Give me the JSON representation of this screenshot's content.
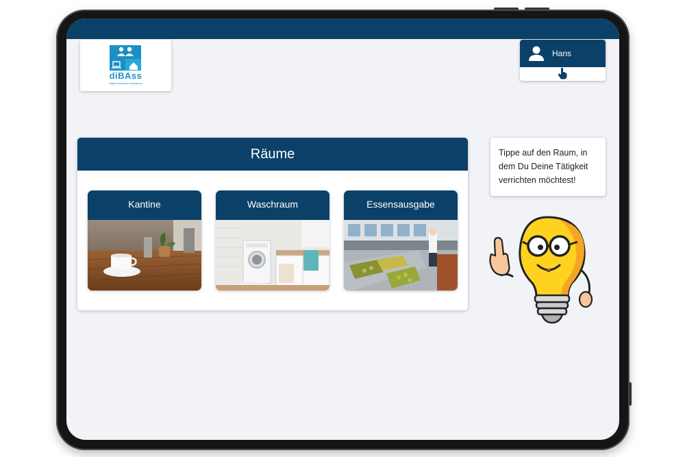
{
  "logo": {
    "name": "diBAss",
    "tagline": "digital Assistant-Assistance"
  },
  "user": {
    "name": "Hans"
  },
  "rooms_panel": {
    "title": "Räume",
    "rooms": [
      {
        "label": "Kantine"
      },
      {
        "label": "Waschraum"
      },
      {
        "label": "Essensausgabe"
      }
    ]
  },
  "hint": {
    "text": "Tippe auf den Raum, in dem Du Deine Tätigkeit verrichten möchtest!"
  },
  "colors": {
    "primary": "#0b4168",
    "background": "#f2f3f7",
    "logo": "#1b8fc6"
  },
  "icons": [
    "user-icon",
    "tap-hand-icon",
    "lightbulb-mascot-icon"
  ]
}
